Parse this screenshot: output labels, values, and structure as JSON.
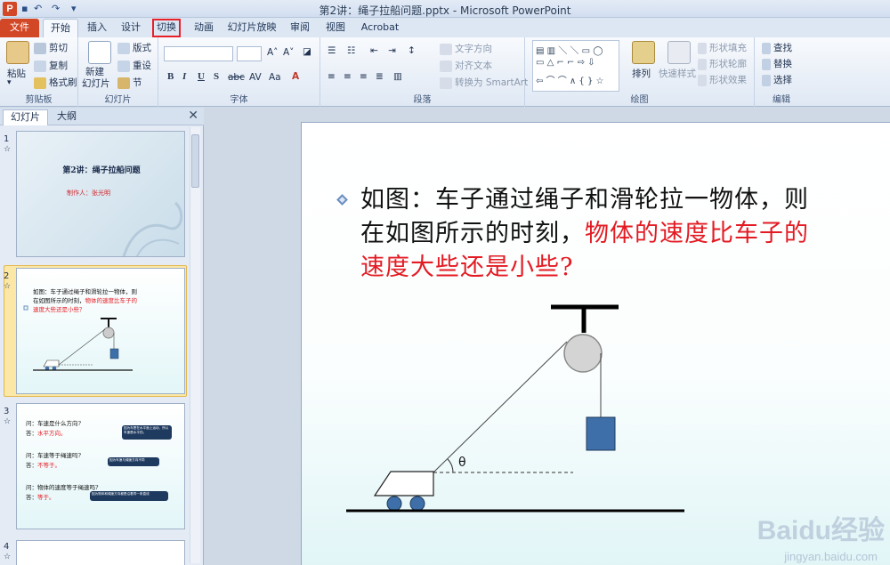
{
  "window": {
    "title": "第2讲：绳子拉船问题.pptx - Microsoft PowerPoint"
  },
  "tabs": [
    {
      "label": "文件"
    },
    {
      "label": "开始"
    },
    {
      "label": "插入"
    },
    {
      "label": "设计"
    },
    {
      "label": "切换"
    },
    {
      "label": "动画"
    },
    {
      "label": "幻灯片放映"
    },
    {
      "label": "审阅"
    },
    {
      "label": "视图"
    },
    {
      "label": "Acrobat"
    }
  ],
  "ribbon": {
    "clipboard": {
      "paste": "粘贴",
      "cut": "剪切",
      "copy": "复制",
      "format_painter": "格式刷",
      "label": "剪贴板"
    },
    "slides": {
      "new_slide_1": "新建",
      "new_slide_2": "幻灯片",
      "layout": "版式",
      "reset": "重设",
      "section": "节",
      "label": "幻灯片"
    },
    "font": {
      "label": "字体",
      "bold": "B",
      "italic": "I",
      "underline": "U",
      "strike": "S",
      "abc": "abc",
      "av": "AV",
      "aa": "Aa"
    },
    "paragraph": {
      "text_direction": "文字方向",
      "align_text": "对齐文本",
      "smartart": "转换为 SmartArt",
      "label": "段落"
    },
    "drawing": {
      "arrange": "排列",
      "quick_styles": "快速样式",
      "shape_fill": "形状填充",
      "shape_outline": "形状轮廓",
      "shape_effects": "形状效果",
      "label": "绘图"
    },
    "editing": {
      "find": "查找",
      "replace": "替换",
      "select": "选择",
      "label": "编辑"
    }
  },
  "left_pane": {
    "tab_slides": "幻灯片",
    "tab_outline": "大纲",
    "close": "✕",
    "thumbnails": [
      {
        "num": "1",
        "note": "☆",
        "title": "第2讲：绳子拉船问题",
        "author": "制作人：张光明"
      },
      {
        "num": "2",
        "note": "☆",
        "q1": "如图：车子通过绳子和滑轮拉一物体，则",
        "q2a": "在如图所示的时刻，",
        "q2b": "物体的速度比车子的",
        "q3": "速度大些还是小些？"
      },
      {
        "num": "3",
        "note": "☆",
        "items": [
          {
            "q": "问：车速是什么方向?",
            "a": "答：",
            "ans": "水平方向。",
            "callout": "因为车是在水平面上运动，所以车速是水平的。"
          },
          {
            "q": "问：车速等于绳速吗?",
            "a": "答：",
            "ans": "不等于。",
            "callout": "因为车速与绳速方向不同"
          },
          {
            "q": "问：物体的速度等于绳速吗?",
            "a": "答：",
            "ans": "等于。",
            "callout": "因为物体和绳速方向都是沿着同一条直线"
          }
        ]
      },
      {
        "num": "4",
        "note": "☆"
      }
    ]
  },
  "slide": {
    "line1": "如图：车子通过绳子和滑轮拉一物体，则",
    "line2_black": "在如图所示的时刻，",
    "line2_red": "物体的速度比车子的",
    "line3_red": "速度大些还是小些?",
    "theta": "θ"
  },
  "watermark": {
    "brand": "Baidu经验",
    "url": "jingyan.baidu.com"
  },
  "colors": {
    "file_tab": "#d24726",
    "accent_red": "#e31b23",
    "block": "#3e6fa8",
    "selected": "#fbe7a6"
  }
}
